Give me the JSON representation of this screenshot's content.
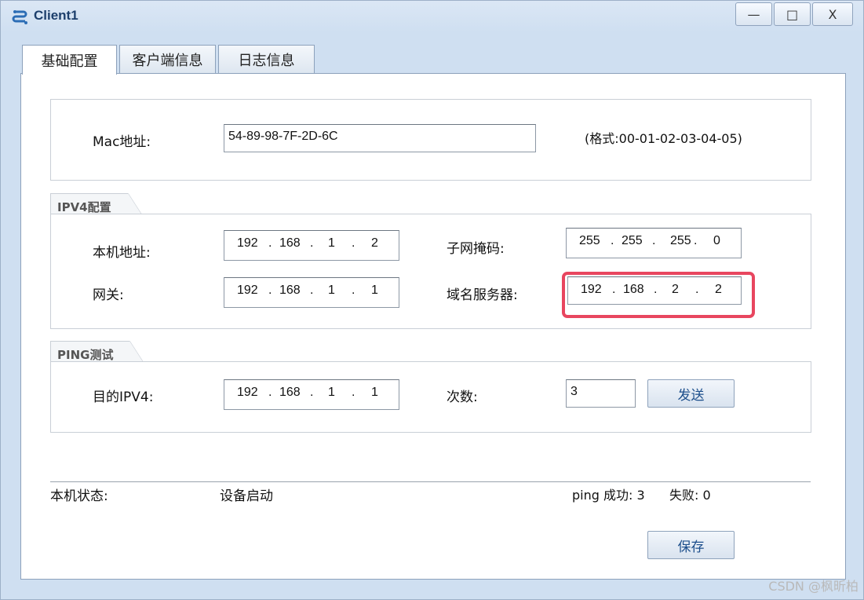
{
  "window": {
    "title": "Client1",
    "minimize": "—",
    "maximize": "□",
    "close": "X"
  },
  "tabs": [
    {
      "label": "基础配置",
      "active": true
    },
    {
      "label": "客户端信息",
      "active": false
    },
    {
      "label": "日志信息",
      "active": false
    }
  ],
  "mac": {
    "label": "Mac地址:",
    "value": "54-89-98-7F-2D-6C",
    "format_hint": "(格式:00-01-02-03-04-05)"
  },
  "ipv4": {
    "group_title": "IPV4配置",
    "host_label": "本机地址:",
    "host_ip": [
      "192",
      "168",
      "1",
      "2"
    ],
    "mask_label": "子网掩码:",
    "mask_ip": [
      "255",
      "255",
      "255",
      "0"
    ],
    "gateway_label": "网关:",
    "gateway_ip": [
      "192",
      "168",
      "1",
      "1"
    ],
    "dns_label": "域名服务器:",
    "dns_ip": [
      "192",
      "168",
      "2",
      "2"
    ],
    "dot": "."
  },
  "ping": {
    "group_title": "PING测试",
    "target_label": "目的IPV4:",
    "target_ip": [
      "192",
      "168",
      "1",
      "1"
    ],
    "count_label": "次数:",
    "count_value": "3",
    "send_button": "发送"
  },
  "status": {
    "label": "本机状态:",
    "value": "设备启动",
    "ping_result": "ping 成功: 3",
    "fail_result": "失败: 0"
  },
  "save_button": "保存",
  "watermark": "CSDN @枫昕柏",
  "colors": {
    "highlight": "#e8465f",
    "title_text": "#1d3f6c"
  }
}
